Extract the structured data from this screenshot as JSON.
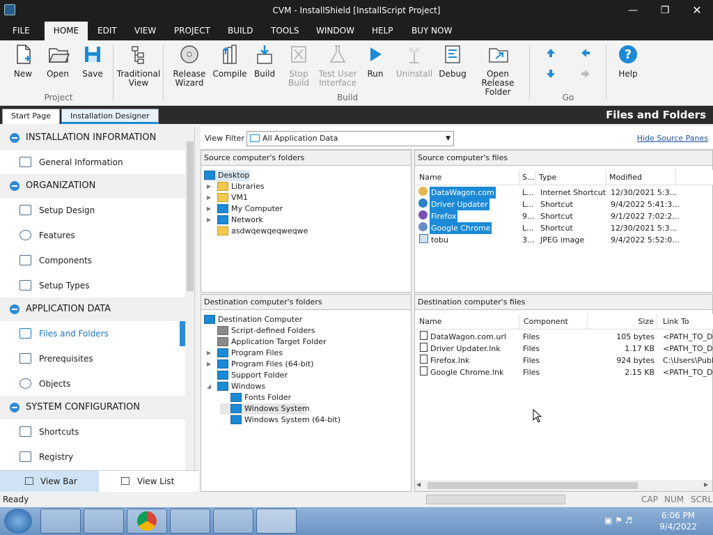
{
  "window": {
    "title": "CVM - InstallShield [InstallScript Project]"
  },
  "menu": [
    "FILE",
    "HOME",
    "EDIT",
    "VIEW",
    "PROJECT",
    "BUILD",
    "TOOLS",
    "WINDOW",
    "HELP",
    "BUY NOW"
  ],
  "ribbon": {
    "new": "New",
    "open": "Open",
    "save": "Save",
    "project_group": "Project",
    "traditional_view": [
      "Traditional",
      "View"
    ],
    "release_wizard": [
      "Release",
      "Wizard"
    ],
    "compile": "Compile",
    "build": "Build",
    "stop_build": [
      "Stop",
      "Build"
    ],
    "test_ui": [
      "Test User",
      "Interface"
    ],
    "run": "Run",
    "uninstall": "Uninstall",
    "debug": "Debug",
    "open_release": [
      "Open Release",
      "Folder"
    ],
    "build_group": "Build",
    "go_group": "Go",
    "help": "Help"
  },
  "tabs": {
    "start": "Start Page",
    "designer": "Installation Designer"
  },
  "page_title": "Files and Folders",
  "nav": {
    "cat1": "INSTALLATION INFORMATION",
    "general_info": "General Information",
    "cat2": "ORGANIZATION",
    "setup_design": "Setup Design",
    "features": "Features",
    "components": "Components",
    "setup_types": "Setup Types",
    "cat3": "APPLICATION DATA",
    "files_folders": "Files and Folders",
    "prerequisites": "Prerequisites",
    "objects": "Objects",
    "cat4": "SYSTEM CONFIGURATION",
    "shortcuts": "Shortcuts",
    "registry": "Registry"
  },
  "viewbar": {
    "view_bar": "View Bar",
    "view_list": "View List"
  },
  "filter": {
    "label": "View Filter",
    "value": "All Application Data",
    "hide_link": "Hide Source Panes"
  },
  "src_folders": {
    "header": "Source computer's folders",
    "items": [
      "Desktop",
      "Libraries",
      "VM1",
      "My Computer",
      "Network",
      "asdwqewqeqweqwe"
    ]
  },
  "src_files": {
    "header": "Source computer's files",
    "columns": [
      "Name",
      "S...",
      "Type",
      "Modified"
    ],
    "rows": [
      {
        "name": "DataWagon.com",
        "s": "L...",
        "type": "Internet Shortcut",
        "modified": "12/30/2021 5:3..."
      },
      {
        "name": "Driver Updater",
        "s": "L...",
        "type": "Shortcut",
        "modified": "9/4/2022 5:41:3..."
      },
      {
        "name": "Firefox",
        "s": "9...",
        "type": "Shortcut",
        "modified": "9/1/2022 7:02:2..."
      },
      {
        "name": "Google Chrome",
        "s": "L...",
        "type": "Shortcut",
        "modified": "12/30/2021 5:3..."
      },
      {
        "name": "tobu",
        "s": "3...",
        "type": "JPEG image",
        "modified": "9/4/2022 5:52:0..."
      }
    ]
  },
  "dst_folders": {
    "header": "Destination computer's folders",
    "items": [
      "Destination Computer",
      "Script-defined Folders",
      "Application Target Folder",
      "Program Files",
      "Program Files (64-bit)",
      "Support Folder",
      "Windows",
      "Fonts Folder",
      "Windows System",
      "Windows System (64-bit)"
    ]
  },
  "dst_files": {
    "header": "Destination computer's files",
    "columns": [
      "Name",
      "Component",
      "Size",
      "Link To"
    ],
    "rows": [
      {
        "name": "DataWagon.com.url",
        "component": "Files",
        "size": "105 bytes",
        "link": "<PATH_TO_DE"
      },
      {
        "name": "Driver Updater.lnk",
        "component": "Files",
        "size": "1.17 KB",
        "link": "<PATH_TO_DE"
      },
      {
        "name": "Firefox.lnk",
        "component": "Files",
        "size": "924 bytes",
        "link": "C:\\Users\\Publ"
      },
      {
        "name": "Google Chrome.lnk",
        "component": "Files",
        "size": "2.15 KB",
        "link": "<PATH_TO_DE"
      }
    ]
  },
  "status": {
    "ready": "Ready",
    "cap": "CAP",
    "num": "NUM",
    "scrl": "SCRL"
  },
  "taskbar": {
    "time": "6:06 PM",
    "date": "9/4/2022"
  }
}
